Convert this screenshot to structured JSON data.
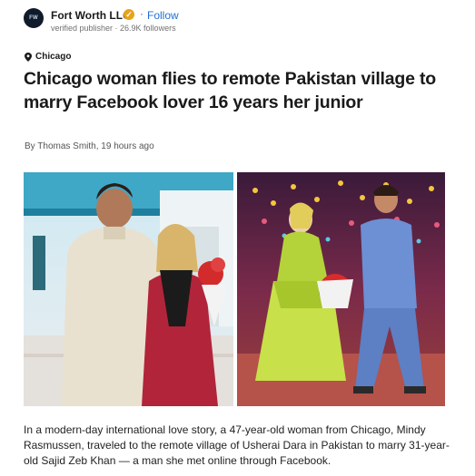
{
  "publisher": {
    "logo_text": "FW",
    "name": "Fort Worth LLC",
    "verified_icon": "verified-badge-icon",
    "separator": "·",
    "follow_label": "Follow",
    "meta": "verified publisher · 26.9K followers"
  },
  "article": {
    "location": "Chicago",
    "location_icon": "map-pin-icon",
    "headline": "Chicago woman flies to remote Pakistan village to marry Facebook lover 16 years her junior",
    "byline": "By Thomas Smith, 19 hours ago",
    "body": "In a modern-day international love story, a 47-year-old woman from Chicago, Mindy Rasmussen, traveled to the remote village of Usherai Dara in Pakistan to marry 31-year-old Sajid Zeb Khan — a man she met online through Facebook."
  },
  "colors": {
    "follow": "#1f6fd0",
    "verified": "#e8a317"
  }
}
